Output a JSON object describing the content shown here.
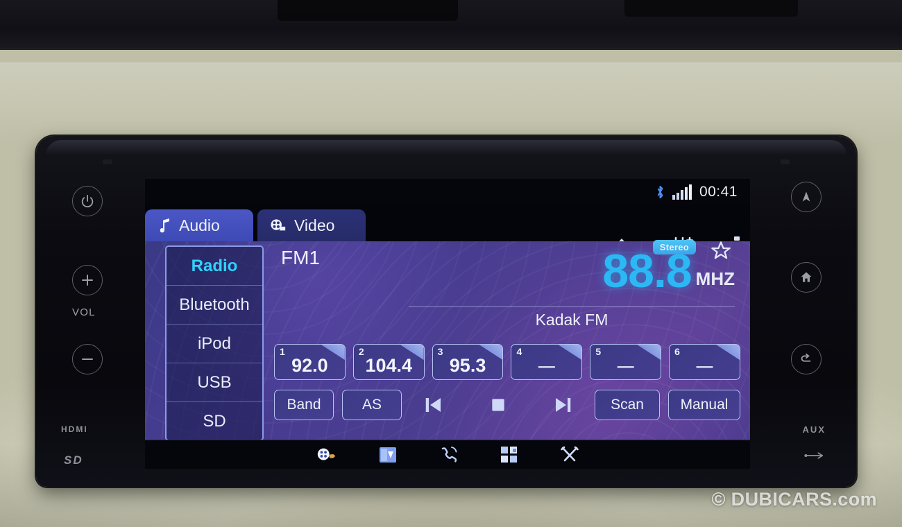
{
  "device": {
    "left_bezel": {
      "power_icon": "power-icon",
      "vol_up_icon": "plus-icon",
      "vol_label": "VOL",
      "vol_down_icon": "minus-icon",
      "hdmi_label": "HDMI",
      "sd_label": "SD"
    },
    "right_bezel": {
      "nav_icon": "navigation-arrow-icon",
      "home_icon": "home-icon",
      "back_icon": "back-arrow-icon",
      "aux_label": "AUX",
      "usb_icon": "usb-icon"
    }
  },
  "status_bar": {
    "bluetooth_icon": "bluetooth-icon",
    "signal_icon": "signal-bars-icon",
    "clock": "00:41"
  },
  "tabs": [
    {
      "label": "Audio",
      "icon": "music-note-icon",
      "active": true
    },
    {
      "label": "Video",
      "icon": "film-reel-icon",
      "active": false
    }
  ],
  "top_icons": [
    {
      "name": "eject-icon"
    },
    {
      "name": "equalizer-icon"
    },
    {
      "name": "more-menu-icon"
    }
  ],
  "sources": [
    {
      "label": "Radio",
      "active": true
    },
    {
      "label": "Bluetooth",
      "active": false
    },
    {
      "label": "iPod",
      "active": false
    },
    {
      "label": "USB",
      "active": false
    },
    {
      "label": "SD",
      "active": false
    }
  ],
  "radio": {
    "band": "FM1",
    "frequency": "88.8",
    "unit": "MHZ",
    "stereo_badge": "Stereo",
    "favorite_icon": "star-outline-icon",
    "station_name": "Kadak FM"
  },
  "presets": [
    {
      "num": "1",
      "value": "92.0",
      "empty": false
    },
    {
      "num": "2",
      "value": "104.4",
      "empty": false
    },
    {
      "num": "3",
      "value": "95.3",
      "empty": false
    },
    {
      "num": "4",
      "value": "—",
      "empty": true
    },
    {
      "num": "5",
      "value": "—",
      "empty": true
    },
    {
      "num": "6",
      "value": "—",
      "empty": true
    }
  ],
  "controls": {
    "band": "Band",
    "auto_store": "AS",
    "prev_icon": "previous-track-icon",
    "stop_icon": "stop-icon",
    "next_icon": "next-track-icon",
    "scan": "Scan",
    "manual": "Manual"
  },
  "dock": [
    {
      "name": "media-palette-icon"
    },
    {
      "name": "navigation-map-icon"
    },
    {
      "name": "phone-icon"
    },
    {
      "name": "apps-grid-icon"
    },
    {
      "name": "tools-settings-icon"
    }
  ],
  "watermark": "© DUBICARS.com",
  "colors": {
    "accent_cyan": "#2bb8f5",
    "tab_active": "#4a57c6",
    "screen_bg": "#473c92",
    "outline": "#b6c2f2"
  }
}
